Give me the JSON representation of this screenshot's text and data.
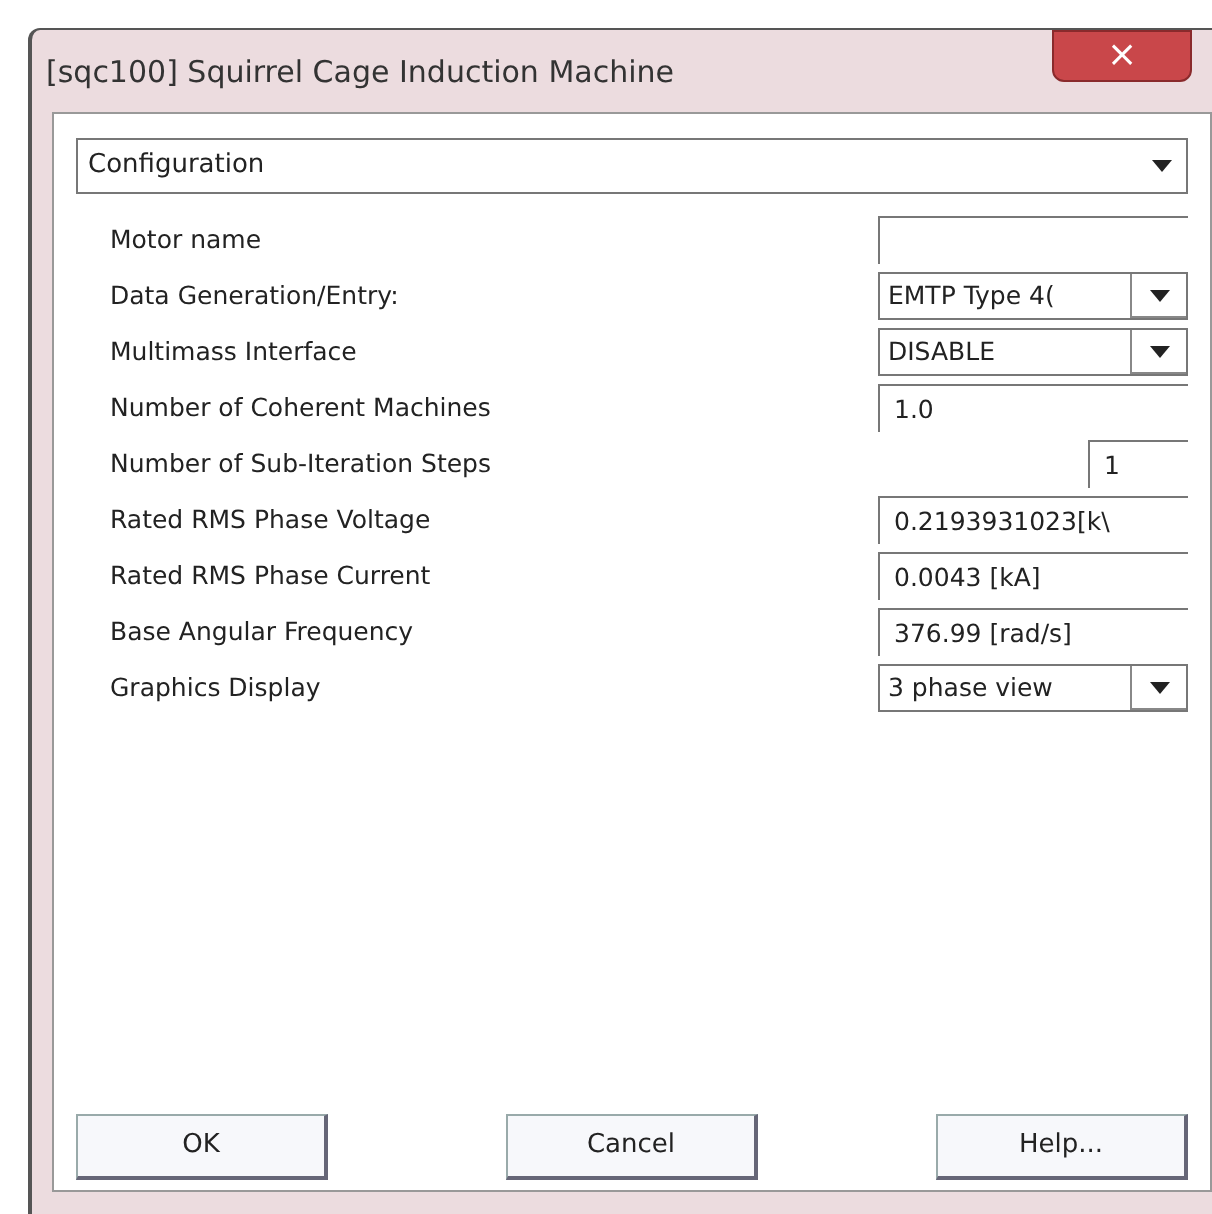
{
  "window": {
    "title": "[sqc100] Squirrel Cage Induction Machine",
    "close": "×"
  },
  "section": {
    "value": "Configuration"
  },
  "fields": [
    {
      "label": "Motor name",
      "kind": "text"
    },
    {
      "label": "Data Generation/Entry:",
      "kind": "combo",
      "value": "EMTP Type 4("
    },
    {
      "label": "Multimass Interface",
      "kind": "combo",
      "value": "DISABLE"
    },
    {
      "label": "Number of Coherent Machines",
      "kind": "text",
      "value": "1.0"
    },
    {
      "label": "Number of Sub-Iteration Steps",
      "kind": "short",
      "value": "1"
    },
    {
      "label": "Rated RMS Phase Voltage",
      "kind": "text",
      "value": "0.2193931023[k\\"
    },
    {
      "label": "Rated RMS Phase Current",
      "kind": "text",
      "value": "0.0043 [kA]"
    },
    {
      "label": "Base Angular Frequency",
      "kind": "text",
      "value": "376.99 [rad/s]"
    },
    {
      "label": "Graphics Display",
      "kind": "combo",
      "value": "3 phase view"
    }
  ],
  "buttons": [
    {
      "label": "OK"
    },
    {
      "label": "Cancel"
    },
    {
      "label": "Help..."
    }
  ]
}
